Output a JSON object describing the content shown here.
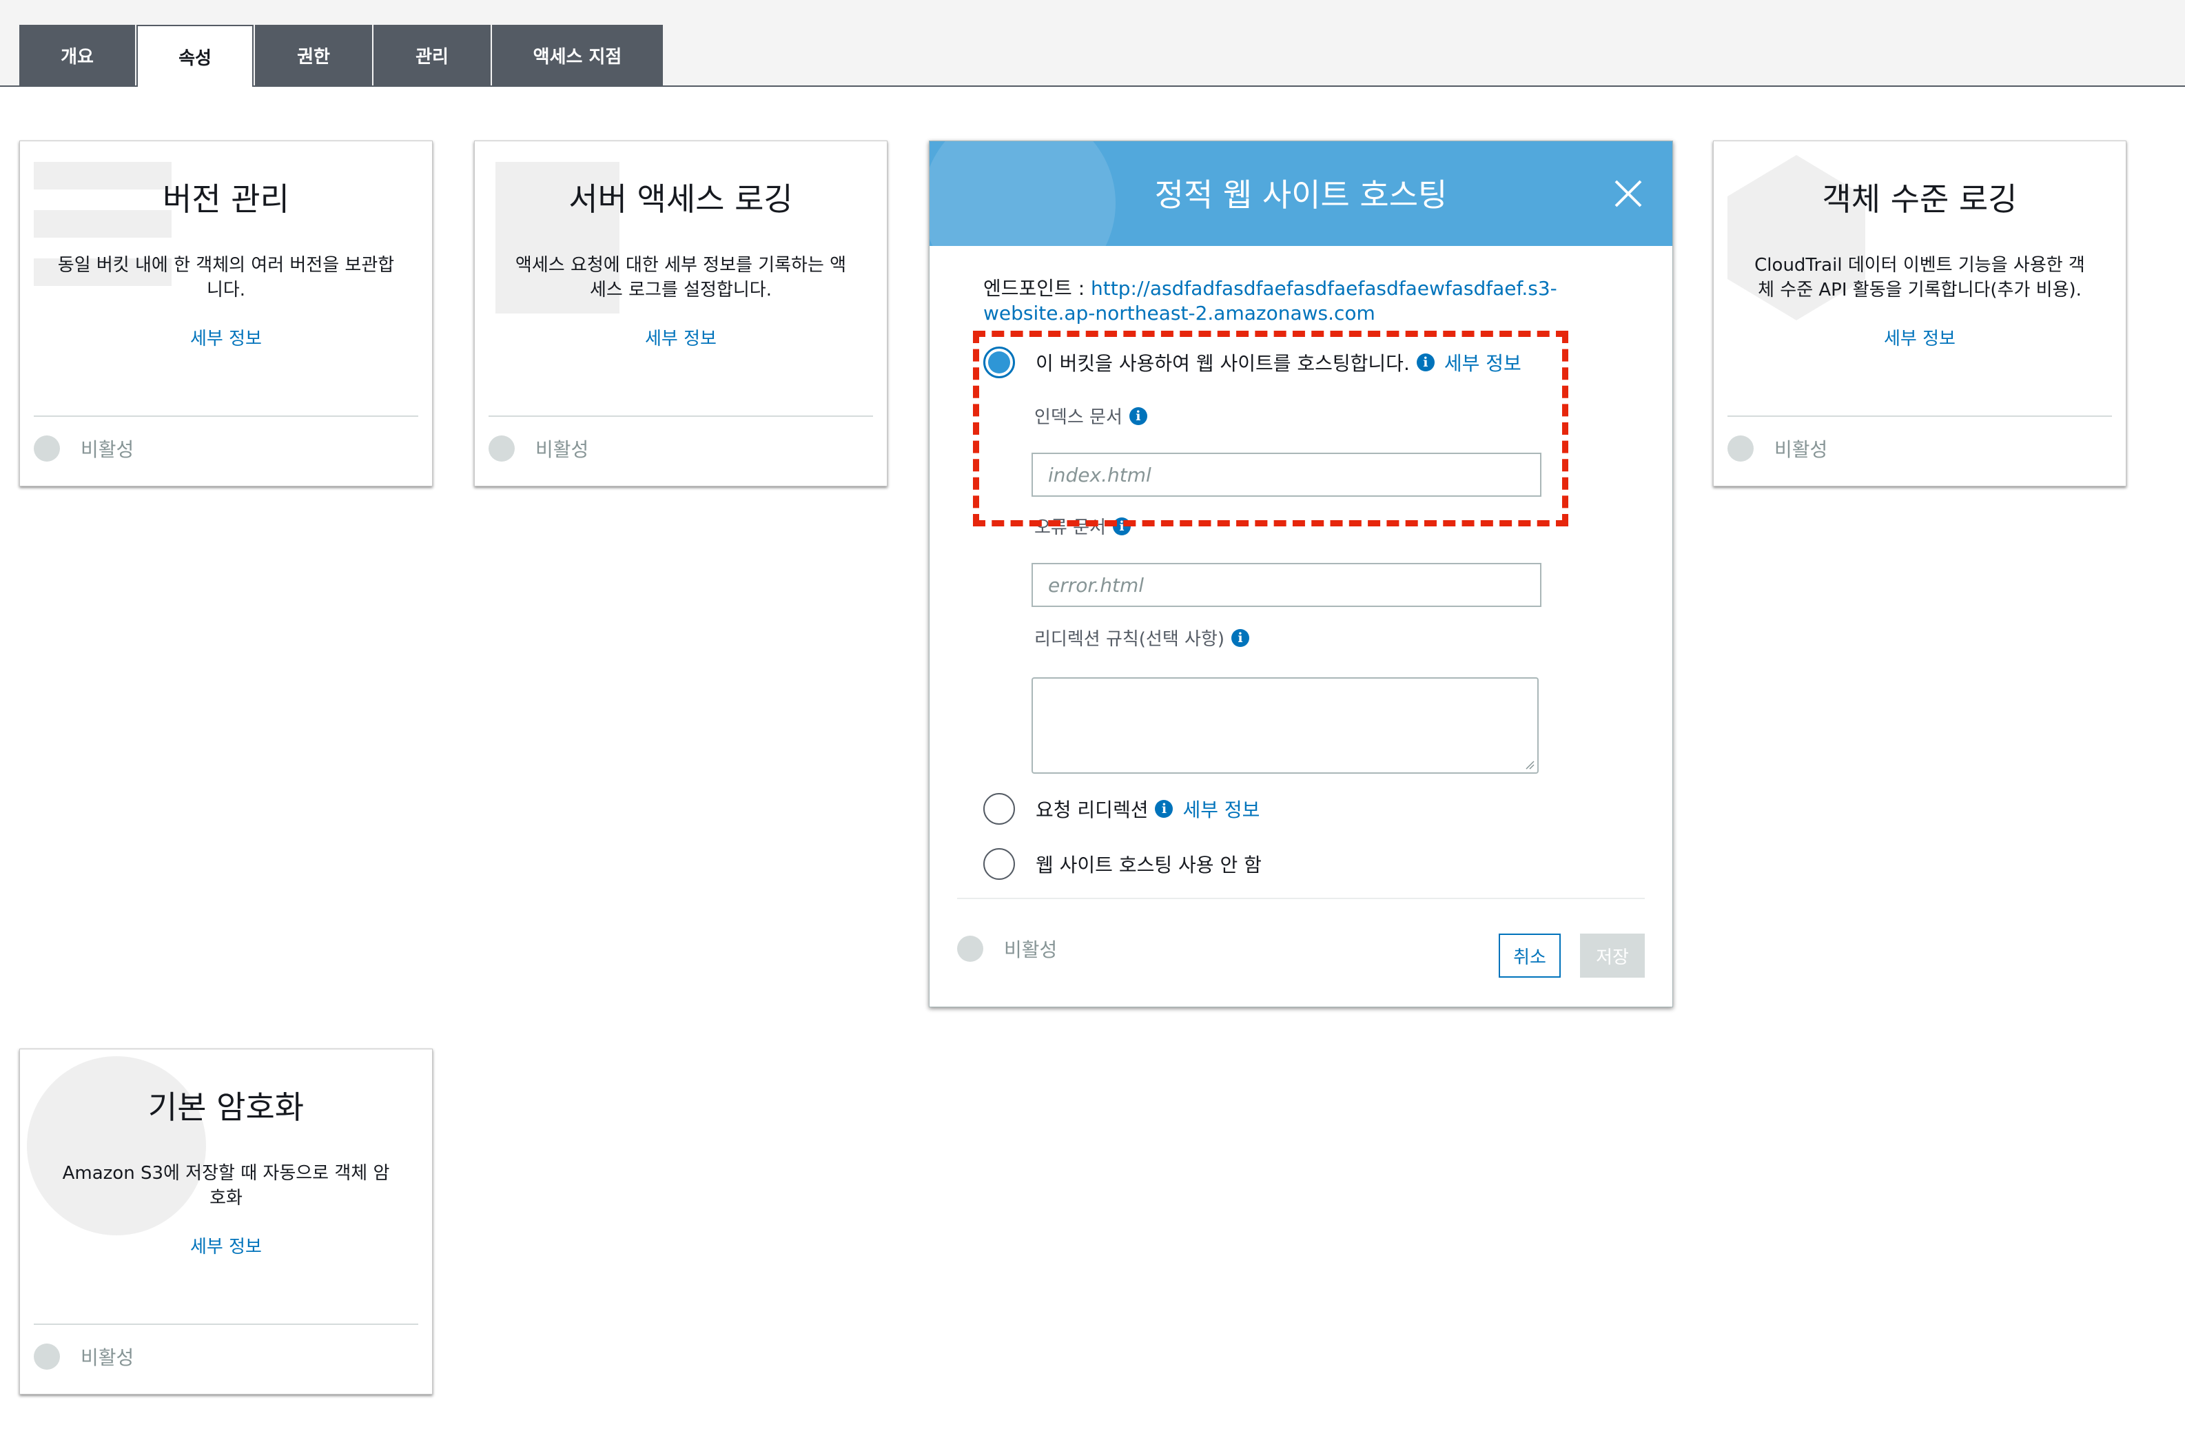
{
  "tabs": [
    {
      "label": "개요"
    },
    {
      "label": "속성"
    },
    {
      "label": "권한"
    },
    {
      "label": "관리"
    },
    {
      "label": "액세스 지점"
    }
  ],
  "cards": {
    "versioning": {
      "title": "버전 관리",
      "desc": "동일 버킷 내에 한 객체의 여러 버전을 보관합니다.",
      "link": "세부 정보",
      "status": "비활성"
    },
    "server_logging": {
      "title": "서버 액세스 로깅",
      "desc": "액세스 요청에 대한 세부 정보를 기록하는 액세스 로그를 설정합니다.",
      "link": "세부 정보",
      "status": "비활성"
    },
    "object_logging": {
      "title": "객체 수준 로깅",
      "desc": "CloudTrail 데이터 이벤트 기능을 사용한 객체 수준 API 활동을 기록합니다(추가 비용).",
      "link": "세부 정보",
      "status": "비활성"
    },
    "encryption": {
      "title": "기본 암호화",
      "desc": "Amazon S3에 저장할 때 자동으로 객체 암호화",
      "link": "세부 정보",
      "status": "비활성"
    }
  },
  "modal": {
    "title": "정적 웹 사이트 호스팅",
    "endpoint_label": "엔드포인트 : ",
    "endpoint_url": "http://asdfadfasdfaefasdfaefasdfaewfasdfaef.s3-website.ap-northeast-2.amazonaws.com",
    "option_host": "이 버킷을 사용하여 웹 사이트를 호스팅합니다.",
    "option_host_link": "세부 정보",
    "index_label": "인덱스 문서",
    "index_placeholder": "index.html",
    "error_label": "오류 문서",
    "error_placeholder": "error.html",
    "redirect_rules_label": "리디렉션 규칙(선택 사항)",
    "option_redirect": "요청 리디렉션",
    "option_redirect_link": "세부 정보",
    "option_disable": "웹 사이트 호스팅 사용 안 함",
    "status": "비활성",
    "cancel": "취소",
    "save": "저장",
    "selected_option": "host"
  },
  "colors": {
    "modal_header": "#52a8dc",
    "tab_bg": "#545b64",
    "link": "#0073bb",
    "annotation": "#e6260c"
  }
}
